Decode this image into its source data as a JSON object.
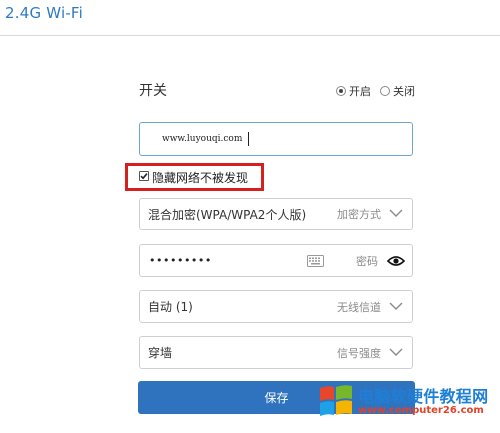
{
  "header": {
    "title": "2.4G Wi-Fi"
  },
  "switch": {
    "label": "开关",
    "on_label": "开启",
    "off_label": "关闭",
    "selected": "开启"
  },
  "ssid": {
    "value": "www.luyouqi.com"
  },
  "hide_network": {
    "label": "隐藏网络不被发现",
    "checked": true
  },
  "encryption": {
    "value": "混合加密(WPA/WPA2个人版)",
    "hint": "加密方式"
  },
  "password": {
    "masked_value": "•••••••••",
    "hint": "密码"
  },
  "channel": {
    "value": "自动 (1)",
    "hint": "无线信道"
  },
  "signal": {
    "value": "穿墙",
    "hint": "信号强度"
  },
  "save_button": {
    "label": "保存"
  },
  "watermark": {
    "title": "电脑软硬件教程网",
    "url": "www.computer26.com"
  },
  "colors": {
    "title": "#2e7bc4",
    "button": "#2f73bf",
    "highlight": "#d62020",
    "field_focus": "#6ea6d6"
  },
  "icons": [
    "keyboard-icon",
    "eye-icon",
    "chevron-down-icon",
    "checkbox-check-icon",
    "windows-logo-icon"
  ]
}
